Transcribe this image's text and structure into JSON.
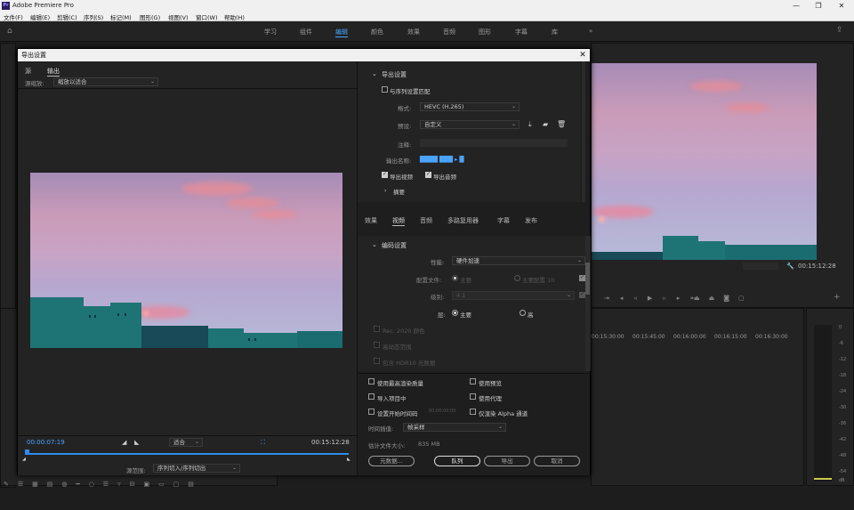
{
  "app": {
    "title": "Adobe Premiere Pro",
    "logo": "Pr"
  },
  "menu": [
    "文件(F)",
    "编辑(E)",
    "剪辑(C)",
    "序列(S)",
    "标记(M)",
    "图形(G)",
    "视图(V)",
    "窗口(W)",
    "帮助(H)"
  ],
  "workspaces": [
    "学习",
    "组件",
    "编辑",
    "颜色",
    "效果",
    "音频",
    "图形",
    "字幕",
    "库"
  ],
  "workspace_active": "编辑",
  "dialog": {
    "title": "导出设置",
    "source": {
      "tabs": [
        "源",
        "输出"
      ],
      "active_tab": "输出",
      "scale_label": "源缩放:",
      "scale_value": "缩放以适合",
      "current_time": "00:00:07:19",
      "fit_value": "适合",
      "end_time": "00:15:12:28",
      "range_label": "源范围:",
      "range_value": "序列切入/序列切出"
    },
    "export_settings": {
      "section": "导出设置",
      "match_sequence": "与序列设置匹配",
      "format_label": "格式:",
      "format_value": "HEVC (H.265)",
      "preset_label": "预设:",
      "preset_value": "自定义",
      "comment_label": "注释:",
      "output_name_label": "输出名称:",
      "output_name_value": "████ ███ ▸ █",
      "export_video": "导出视频",
      "export_audio": "导出音频",
      "summary": "摘要"
    },
    "tabs": [
      "效果",
      "视频",
      "音频",
      "多路复用器",
      "字幕",
      "发布"
    ],
    "active_tab": "视频",
    "encoding": {
      "section": "编码设置",
      "performance_label": "性能:",
      "performance_value": "硬件加速",
      "profile_label": "配置文件:",
      "profile_main": "主要",
      "profile_main10": "主要配置 10",
      "level_label": "级别:",
      "level_value": "4.1",
      "tier_label": "层:",
      "tier_main": "主要",
      "tier_high": "高",
      "rec2020": "Rec. 2020 颜色",
      "hdr": "高动态范围",
      "hdr10": "包含 HDR10 元数据"
    },
    "options": {
      "max_quality": "使用最高渲染质量",
      "use_previews": "使用预览",
      "import_project": "导入项目中",
      "use_proxy": "使用代理",
      "set_start_tc": "设置开始时间码",
      "start_tc_value": "00;00;00;00",
      "alpha_only": "仅渲染 Alpha 通道",
      "interp_label": "时间插值:",
      "interp_value": "帧采样",
      "filesize_label": "估计文件大小:",
      "filesize_value": "835 MB"
    },
    "buttons": {
      "metadata": "元数据...",
      "queue": "队列",
      "export": "导出",
      "cancel": "取消"
    }
  },
  "program_monitor": {
    "timecode": "00:15:12:28"
  },
  "timeline": {
    "ruler": [
      "00:15:30:00",
      "00:15:45:00",
      "00:16:00:00",
      "00:16:15:00",
      "00:16:30:00"
    ]
  },
  "meter": {
    "scale": [
      "0",
      "-6",
      "-12",
      "-18",
      "-24",
      "-30",
      "-36",
      "-42",
      "-48",
      "-54",
      "dB"
    ]
  },
  "colors": {
    "accent": "#4aa3ff",
    "timeline_blue": "#2d8ceb"
  }
}
